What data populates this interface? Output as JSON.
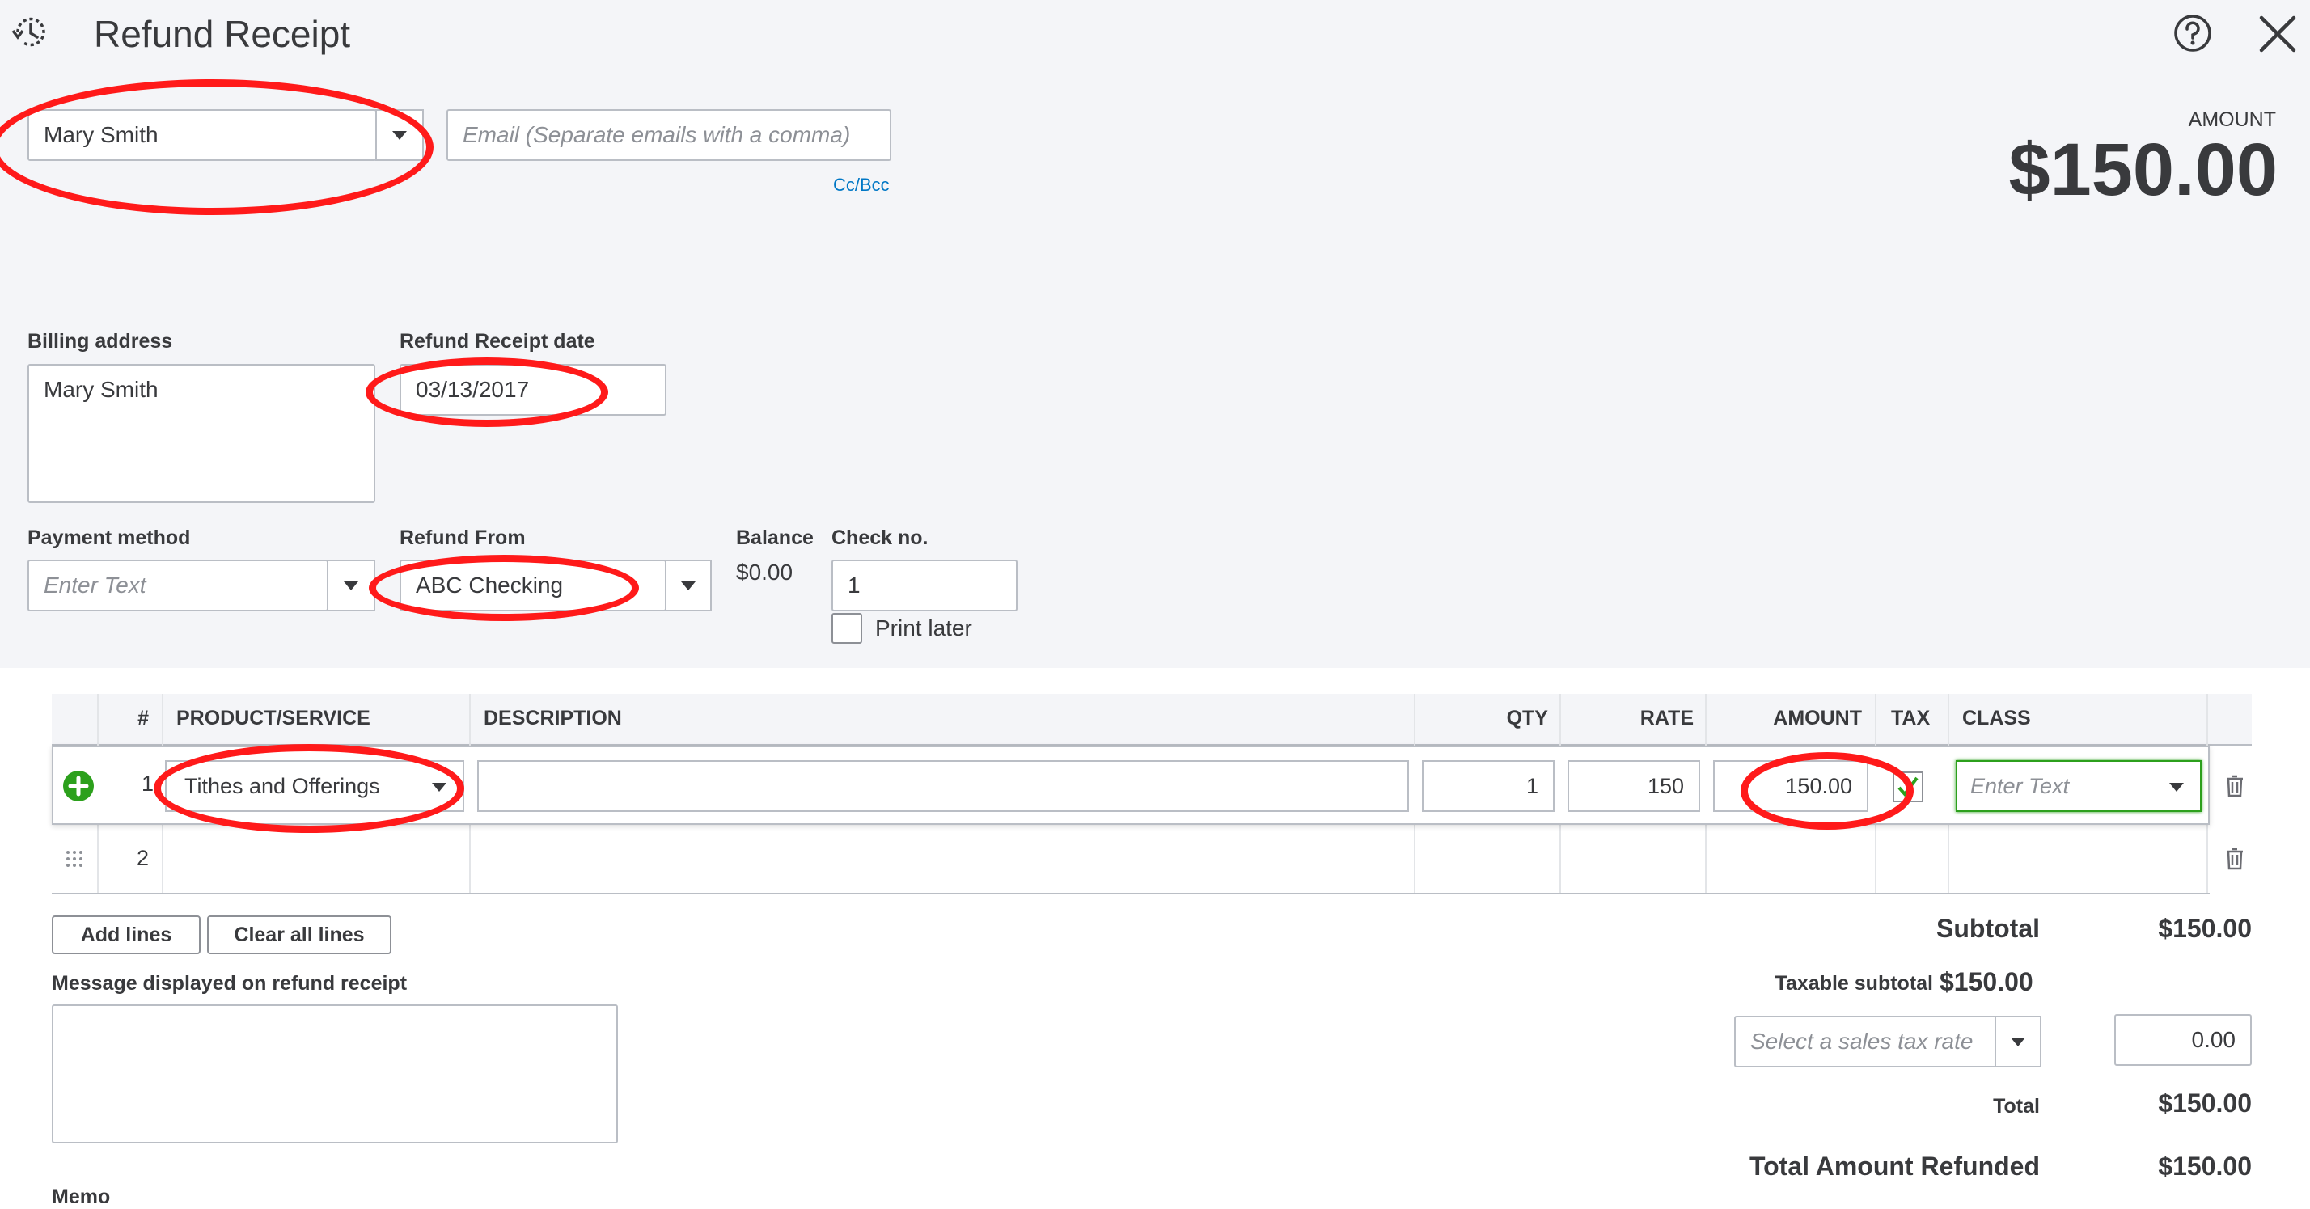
{
  "header": {
    "title": "Refund Receipt",
    "help_icon": "question-circle-icon",
    "close_icon": "close-icon",
    "recent_icon": "clock-history-icon"
  },
  "customer": {
    "value": "Mary Smith"
  },
  "email": {
    "placeholder": "Email (Separate emails with a comma)",
    "ccbcc": "Cc/Bcc"
  },
  "amount": {
    "label": "AMOUNT",
    "value": "$150.00"
  },
  "billing": {
    "label": "Billing address",
    "value": "Mary Smith"
  },
  "date": {
    "label": "Refund Receipt date",
    "value": "03/13/2017"
  },
  "payment_method": {
    "label": "Payment method",
    "placeholder": "Enter Text"
  },
  "refund_from": {
    "label": "Refund From",
    "value": "ABC Checking"
  },
  "balance": {
    "label": "Balance",
    "value": "$0.00"
  },
  "check_no": {
    "label": "Check no.",
    "value": "1"
  },
  "print_later": {
    "label": "Print later",
    "checked": false
  },
  "table": {
    "columns": [
      "#",
      "PRODUCT/SERVICE",
      "DESCRIPTION",
      "QTY",
      "RATE",
      "AMOUNT",
      "TAX",
      "CLASS"
    ],
    "rows": [
      {
        "num": "1",
        "product": "Tithes and Offerings",
        "description": "",
        "qty": "1",
        "rate": "150",
        "amount": "150.00",
        "tax": true,
        "class_placeholder": "Enter Text"
      },
      {
        "num": "2",
        "product": "",
        "description": "",
        "qty": "",
        "rate": "",
        "amount": "",
        "tax": false,
        "class_placeholder": ""
      }
    ]
  },
  "buttons": {
    "add_lines": "Add lines",
    "clear_lines": "Clear all lines"
  },
  "message": {
    "label": "Message displayed on refund receipt",
    "value": ""
  },
  "memo": {
    "label": "Memo"
  },
  "totals": {
    "subtotal_label": "Subtotal",
    "subtotal": "$150.00",
    "taxable_label": "Taxable subtotal",
    "taxable": "$150.00",
    "tax_rate_placeholder": "Select a sales tax rate",
    "tax_amount": "0.00",
    "total_label": "Total",
    "total": "$150.00",
    "refunded_label": "Total Amount Refunded",
    "refunded": "$150.00"
  },
  "colors": {
    "accent_link": "#0077c5",
    "add_green": "#2ca01c",
    "annotation": "#ff1a1a",
    "header_bg": "#f4f5f8"
  }
}
